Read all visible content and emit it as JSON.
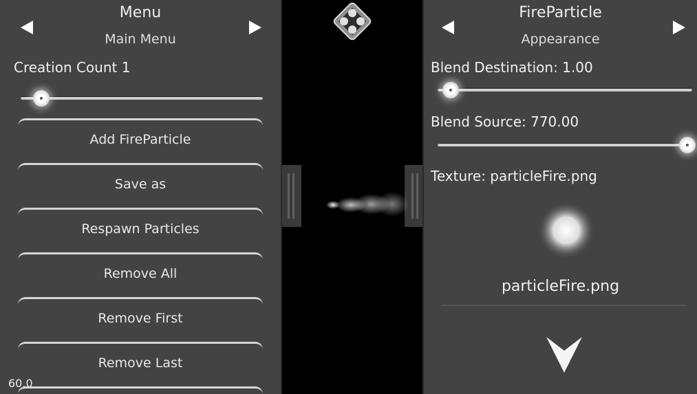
{
  "left_panel": {
    "title": "Menu",
    "subtitle": "Main Menu",
    "creation_count_label": "Creation Count 1",
    "creation_count_slider": 0.07,
    "buttons": [
      "Add FireParticle",
      "Save as",
      "Respawn Particles",
      "Remove All",
      "Remove First",
      "Remove Last"
    ],
    "fps": "60.0"
  },
  "right_panel": {
    "title": "FireParticle",
    "subtitle": "Appearance",
    "blend_destination_label": "Blend Destination: 1.00",
    "blend_destination_slider": 0.05,
    "blend_source_label": "Blend Source: 770.00",
    "blend_source_slider": 0.98,
    "texture_label": "Texture: particleFire.png",
    "texture_filename": "particleFire.png"
  },
  "icons": {
    "left_prev": "triangle-left-icon",
    "left_next": "triangle-right-icon",
    "right_prev": "triangle-left-icon",
    "right_next": "triangle-right-icon",
    "logo": "diamond-logo-icon",
    "down": "chevron-down-icon"
  },
  "colors": {
    "panel_bg": "#434343",
    "viewport_bg": "#000000",
    "text": "#f0f0f0",
    "knob": "#ffffff"
  }
}
